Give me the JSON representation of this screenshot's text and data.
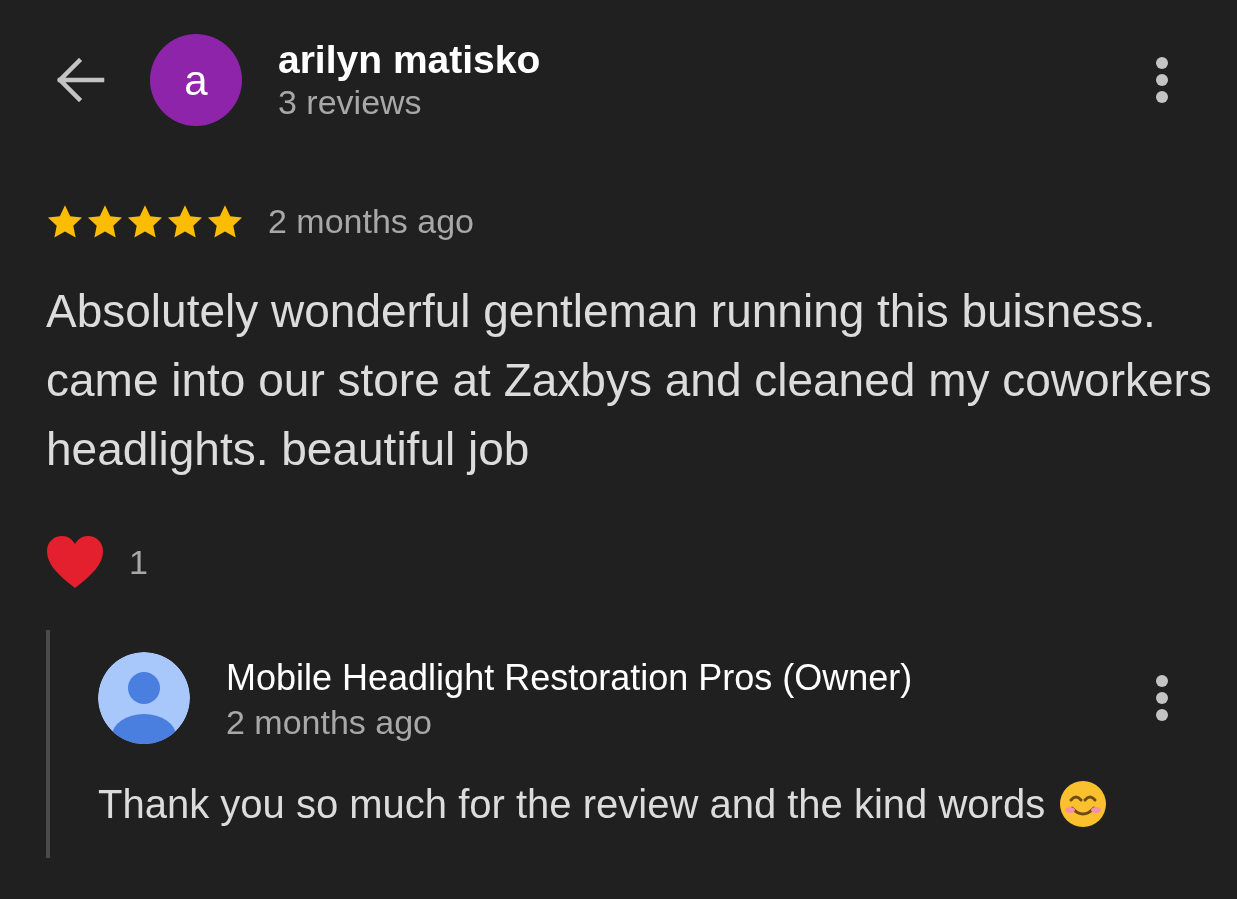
{
  "header": {
    "avatar_letter": "a",
    "name": "arilyn matisko",
    "review_count": "3 reviews"
  },
  "review": {
    "stars": 5,
    "time": "2 months ago",
    "text": "Absolutely wonderful gentleman running this buisness. came into our store at Zaxbys and cleaned my coworkers headlights. beautiful job",
    "reaction_count": "1"
  },
  "reply": {
    "author": "Mobile Headlight Restoration Pros (Owner)",
    "time": "2 months ago",
    "text": "Thank you so much for the review and the kind words"
  }
}
